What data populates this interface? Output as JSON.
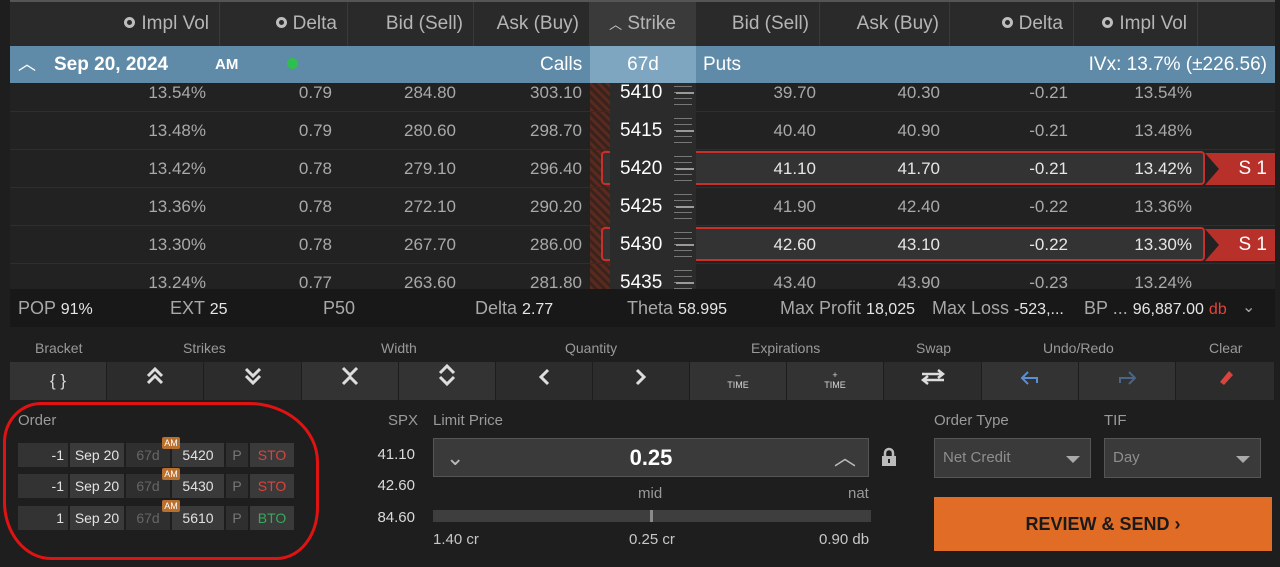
{
  "header": {
    "cols": [
      "Impl Vol",
      "Delta",
      "Bid (Sell)",
      "Ask (Buy)",
      "Strike",
      "Bid (Sell)",
      "Ask (Buy)",
      "Delta",
      "Impl Vol"
    ]
  },
  "expiration": {
    "date": "Sep 20, 2024",
    "session": "AM",
    "calls_label": "Calls",
    "dte": "67d",
    "puts_label": "Puts",
    "ivx": "IVx: 13.7% (±226.56)"
  },
  "chain": [
    {
      "c_iv": "13.54%",
      "c_delta": "0.79",
      "c_bid": "284.80",
      "c_ask": "303.10",
      "strike": "5410",
      "p_bid": "39.70",
      "p_ask": "40.30",
      "p_delta": "-0.21",
      "p_iv": "13.54%"
    },
    {
      "c_iv": "13.48%",
      "c_delta": "0.79",
      "c_bid": "280.60",
      "c_ask": "298.70",
      "strike": "5415",
      "p_bid": "40.40",
      "p_ask": "40.90",
      "p_delta": "-0.21",
      "p_iv": "13.48%"
    },
    {
      "c_iv": "13.42%",
      "c_delta": "0.78",
      "c_bid": "279.10",
      "c_ask": "296.40",
      "strike": "5420",
      "p_bid": "41.10",
      "p_ask": "41.70",
      "p_delta": "-0.21",
      "p_iv": "13.42%",
      "badge": "S 1"
    },
    {
      "c_iv": "13.36%",
      "c_delta": "0.78",
      "c_bid": "272.10",
      "c_ask": "290.20",
      "strike": "5425",
      "p_bid": "41.90",
      "p_ask": "42.40",
      "p_delta": "-0.22",
      "p_iv": "13.36%"
    },
    {
      "c_iv": "13.30%",
      "c_delta": "0.78",
      "c_bid": "267.70",
      "c_ask": "286.00",
      "strike": "5430",
      "p_bid": "42.60",
      "p_ask": "43.10",
      "p_delta": "-0.22",
      "p_iv": "13.30%",
      "badge": "S 1"
    },
    {
      "c_iv": "13.24%",
      "c_delta": "0.77",
      "c_bid": "263.60",
      "c_ask": "281.80",
      "strike": "5435",
      "p_bid": "43.40",
      "p_ask": "43.90",
      "p_delta": "-0.23",
      "p_iv": "13.24%"
    }
  ],
  "stats": {
    "pop_label": "POP",
    "pop": "91%",
    "ext_label": "EXT",
    "ext": "25",
    "p50_label": "P50",
    "delta_label": "Delta",
    "delta": "2.77",
    "theta_label": "Theta",
    "theta": "58.995",
    "maxprofit_label": "Max Profit",
    "maxprofit": "18,025",
    "maxloss_label": "Max Loss",
    "maxloss": "-523,...",
    "bp_label": "BP ...",
    "bp": "96,887.00",
    "bp_suffix": "db"
  },
  "toolbar": {
    "bracket": "Bracket",
    "strikes": "Strikes",
    "width": "Width",
    "quantity": "Quantity",
    "expirations": "Expirations",
    "swap": "Swap",
    "undo_redo": "Undo/Redo",
    "clear": "Clear",
    "bracket_btn": "{ }",
    "time_minus": "TIME",
    "time_plus": "TIME",
    "minus": "–",
    "plus": "+"
  },
  "order": {
    "label": "Order",
    "spx_label": "SPX",
    "legs": [
      {
        "qty": "-1",
        "date": "Sep 20",
        "dte": "67d",
        "am": "AM",
        "strike": "5420",
        "type": "P",
        "action": "STO",
        "spx": "41.10"
      },
      {
        "qty": "-1",
        "date": "Sep 20",
        "dte": "67d",
        "am": "AM",
        "strike": "5430",
        "type": "P",
        "action": "STO",
        "spx": "42.60"
      },
      {
        "qty": "1",
        "date": "Sep 20",
        "dte": "67d",
        "am": "AM",
        "strike": "5610",
        "type": "P",
        "action": "BTO",
        "spx": "84.60"
      }
    ]
  },
  "limit": {
    "label": "Limit Price",
    "value": "0.25",
    "mid_label": "mid",
    "nat_label": "nat",
    "left_value": "1.40 cr",
    "mid_value": "0.25 cr",
    "right_value": "0.90 db",
    "slider_position": 0.5
  },
  "order_type": {
    "label": "Order Type",
    "value": "Net Credit"
  },
  "tif": {
    "label": "TIF",
    "value": "Day"
  },
  "review_button": "REVIEW & SEND ›",
  "colors": {
    "accent": "#e06c25",
    "header_blue": "#5f8aa8",
    "sell": "#d9453c",
    "buy": "#37a85c",
    "highlight": "#e01313"
  }
}
